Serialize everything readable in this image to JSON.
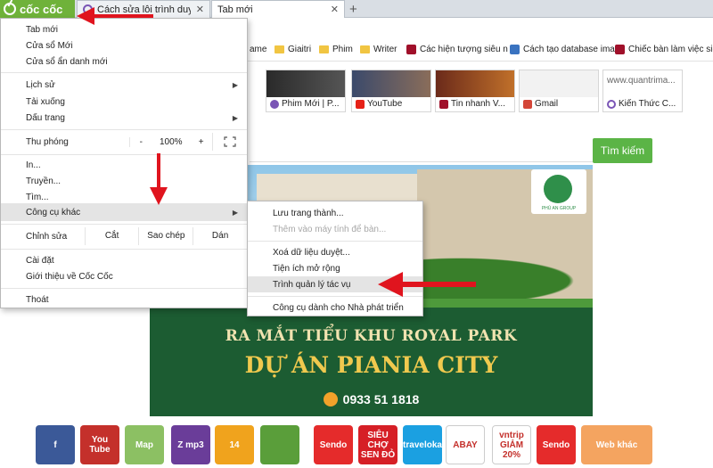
{
  "browser": {
    "brand_label": "cốc cốc",
    "tabs": [
      {
        "title": "Cách sửa lỗi trình duyệt Cốc"
      },
      {
        "title": "Tab mới"
      }
    ]
  },
  "bookmarks": [
    {
      "label": "ame",
      "icon": "folder-icon"
    },
    {
      "label": "Giaitri",
      "icon": "folder-icon"
    },
    {
      "label": "Phim",
      "icon": "folder-icon"
    },
    {
      "label": "Writer",
      "icon": "folder-icon"
    },
    {
      "label": "Các hiện tượng siêu n",
      "icon": "site-icon"
    },
    {
      "label": "Cách tạo database ima",
      "icon": "site-icon"
    },
    {
      "label": "Chiếc bàn làm việc siê",
      "icon": "site-icon"
    }
  ],
  "thumbnails": [
    {
      "label": "Phim Mới | P...",
      "icon_color": "#7a55b5"
    },
    {
      "label": "YouTube",
      "icon_color": "#e62117"
    },
    {
      "label": "Tin nhanh V...",
      "icon_color": "#a0102a"
    },
    {
      "label": "Gmail",
      "icon_color": "#d44638"
    },
    {
      "label": "Kiến Thức C...",
      "icon_color": "#7a55b5",
      "top_text": "www.quantrima..."
    }
  ],
  "search": {
    "button_label": "Tìm kiếm"
  },
  "banner": {
    "line1": "RA MẮT TIỂU KHU ROYAL PARK",
    "line2": "DỰ ÁN PIANIA CITY",
    "phone": "0933 51 1818",
    "badge_text": "PHÚ AN GROUP"
  },
  "menu": {
    "items_top": [
      {
        "label": "Tab mới"
      },
      {
        "label": "Cửa sổ Mới"
      },
      {
        "label": "Cửa sổ ẩn danh mới"
      }
    ],
    "history": "Lịch sử",
    "downloads": "Tải xuống",
    "bookmarks": "Dấu trang",
    "zoom_label": "Thu phóng",
    "zoom_minus": "-",
    "zoom_value": "100%",
    "zoom_plus": "+",
    "print": "In...",
    "cast": "Truyền...",
    "find": "Tìm...",
    "more_tools": "Công cụ khác",
    "edit_label": "Chỉnh sửa",
    "cut": "Cắt",
    "copy": "Sao chép",
    "paste": "Dán",
    "settings": "Cài đặt",
    "about": "Giới thiệu về Cốc Cốc",
    "exit": "Thoát"
  },
  "submenu": {
    "save_page": "Lưu trang thành...",
    "add_to_desktop": "Thêm vào máy tính để bàn...",
    "clear_data": "Xoá dữ liệu duyệt...",
    "extensions": "Tiện ích mở rộng",
    "task_manager": "Trình quản lý tác vụ",
    "dev_tools": "Công cụ dành cho Nhà phát triển"
  },
  "shortcuts": [
    {
      "label": "f",
      "color": "#3b5998"
    },
    {
      "label": "You Tube",
      "color": "#c4302b"
    },
    {
      "label": "Map",
      "color": "#8cc063"
    },
    {
      "label": "Z mp3",
      "color": "#6a3d99"
    },
    {
      "label": "14",
      "color": "#f0a31d"
    },
    {
      "label": "",
      "color": "#5a9e3a"
    },
    {
      "label": "Sendo",
      "color": "#e52b2b"
    },
    {
      "label": "SIÊU CHỢ SEN ĐỎ",
      "color": "#d61f26"
    },
    {
      "label": "traveloka",
      "color": "#1ba0e1"
    },
    {
      "label": "ABAY",
      "color": "#ffffff"
    },
    {
      "label": "vntrip GIẢM 20%",
      "color": "#ffffff"
    },
    {
      "label": "Sendo",
      "color": "#e52b2b"
    },
    {
      "label": "Web khác",
      "color": "#f4a460"
    }
  ]
}
